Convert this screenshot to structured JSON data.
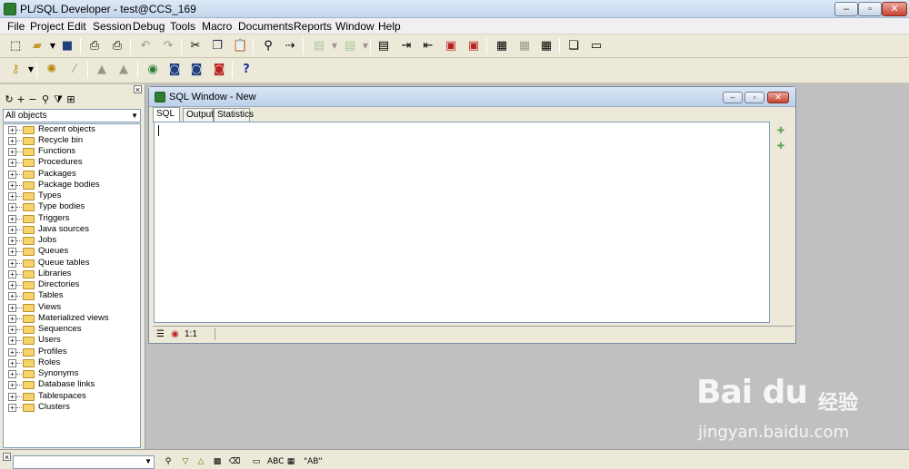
{
  "app": {
    "title": "PL/SQL Developer - test@CCS_169",
    "window_controls": {
      "minimize": "–",
      "maximize": "▫",
      "close": "✕"
    }
  },
  "menu": [
    "File",
    "Project",
    "Edit",
    "Session",
    "Debug",
    "Tools",
    "Macro",
    "Documents",
    "Reports",
    "Window",
    "Help"
  ],
  "toolbar1": {
    "icons": [
      "new-icon",
      "open-icon",
      "save-icon",
      "print-icon",
      "print-setup-icon",
      "undo-icon",
      "redo-icon",
      "cut-icon",
      "copy-icon",
      "paste-icon",
      "find-icon",
      "replace-icon",
      "execute-icon",
      "next-icon",
      "comment-icon",
      "indent-icon",
      "unindent-icon",
      "uppercase-icon",
      "lowercase-icon",
      "query-builder-icon",
      "explain-icon",
      "beautifier-icon",
      "window-list-icon",
      "tile-icon"
    ]
  },
  "toolbar2": {
    "icons": [
      "key-icon",
      "compile-icon",
      "wand-icon",
      "commit-icon",
      "rollback-icon",
      "user-icon",
      "psql-icon",
      "session-icon",
      "log-icon"
    ],
    "help_glyph": "?"
  },
  "object_browser": {
    "filter": "All objects",
    "items": [
      "Recent objects",
      "Recycle bin",
      "Functions",
      "Procedures",
      "Packages",
      "Package bodies",
      "Types",
      "Type bodies",
      "Triggers",
      "Java sources",
      "Jobs",
      "Queues",
      "Queue tables",
      "Libraries",
      "Directories",
      "Tables",
      "Views",
      "Materialized views",
      "Sequences",
      "Users",
      "Profiles",
      "Roles",
      "Synonyms",
      "Database links",
      "Tablespaces",
      "Clusters"
    ]
  },
  "sql_window": {
    "title": "SQL Window - New",
    "tabs": [
      "SQL",
      "Output",
      "Statistics"
    ],
    "active_tab": "SQL",
    "editor_text": "",
    "cursor_position": "1:1"
  },
  "bottom_bar": {
    "search_value": "",
    "labels": {
      "abc": "ABC",
      "ab_quoted": "\"AB\""
    }
  },
  "watermark": {
    "logo": "Bai du",
    "chinese": "经验",
    "url": "jingyan.baidu.com"
  },
  "colors": {
    "title_bar": "#c4d6ec",
    "toolbar_bg": "#ece9d8",
    "mdi_bg": "#c0c0c0",
    "folder": "#f6d46b",
    "close_button": "#c7432f"
  }
}
